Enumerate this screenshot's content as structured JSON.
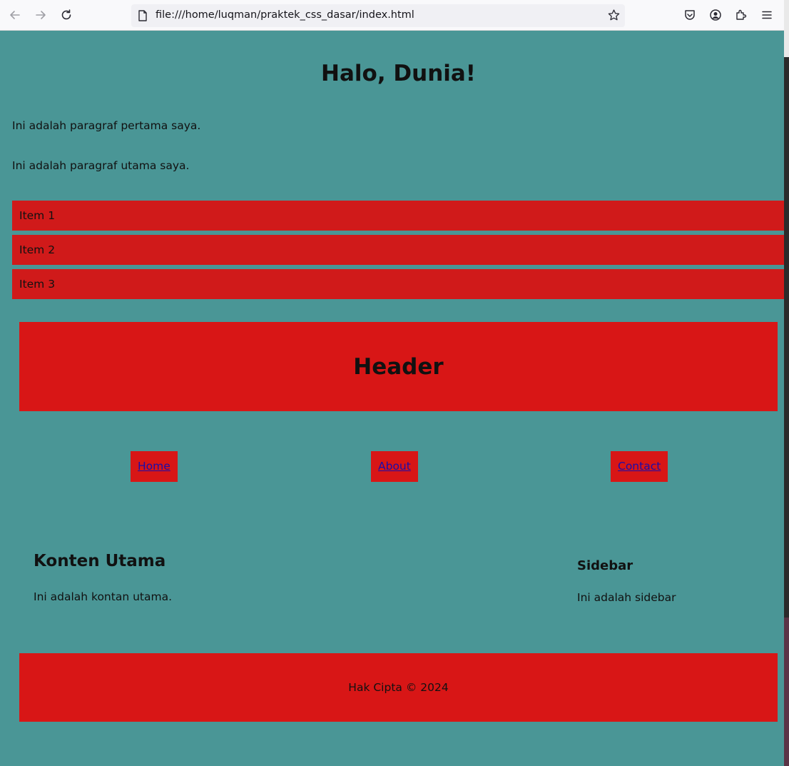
{
  "browser": {
    "url": "file:///home/luqman/praktek_css_dasar/index.html"
  },
  "page": {
    "heading": "Halo, Dunia!",
    "paragraph_first": "Ini adalah paragraf pertama saya.",
    "paragraph_main": "Ini adalah paragraf utama saya.",
    "list_items": [
      "Item 1",
      "Item 2",
      "Item 3"
    ],
    "header_text": "Header",
    "nav": {
      "home": "Home",
      "about": "About",
      "contact": "Contact"
    },
    "main_content": {
      "title": "Konten Utama",
      "text": "Ini adalah kontan utama."
    },
    "sidebar": {
      "title": "Sidebar",
      "text": "Ini adalah sidebar"
    },
    "footer_text": "Hak Cipta © 2024"
  },
  "colors": {
    "page_background": "#4a9696",
    "block_red": "#d81616",
    "list_red": "#d01a1a",
    "link": "#1a0dab"
  }
}
